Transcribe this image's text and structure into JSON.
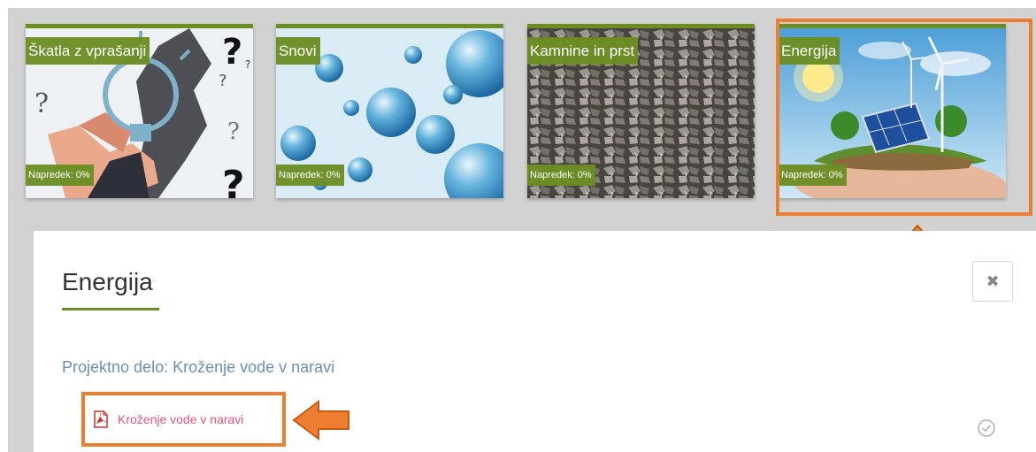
{
  "tiles": [
    {
      "title": "Škatla z vprašanji",
      "progress": "Napredek: 0%",
      "image": "lightbulb-question-hand-image"
    },
    {
      "title": "Snovi",
      "progress": "Napredek: 0%",
      "image": "water-molecules-image"
    },
    {
      "title": "Kamnine in prst",
      "progress": "Napredek: 0%",
      "image": "gravel-stones-image"
    },
    {
      "title": "Energija",
      "progress": "Napredek: 0%",
      "image": "solar-wind-hand-image"
    }
  ],
  "panel": {
    "title": "Energija",
    "close_icon": "close-icon",
    "section_title": "Projektno delo: Kroženje vode v naravi",
    "resource": {
      "label": "Kroženje vode v naravi",
      "icon": "pdf-icon",
      "status_icon": "completion-check-icon"
    }
  },
  "colors": {
    "accent_green": "#6b8e23",
    "highlight_orange": "#ed7d31",
    "link_blue": "#6b8fb8",
    "resource_pink": "#e8527a",
    "background_gray": "#d2d2d2"
  }
}
